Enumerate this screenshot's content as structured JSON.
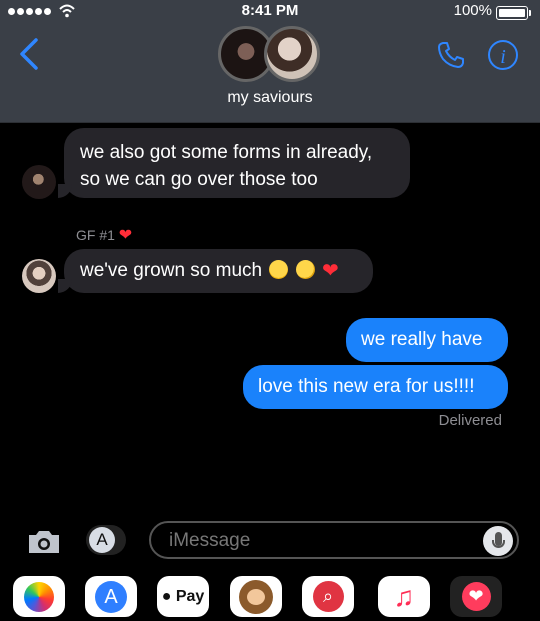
{
  "status": {
    "time": "8:41 PM",
    "battery": "100%"
  },
  "nav": {
    "group_name": "my saviours"
  },
  "messages": [
    {
      "text_line1": "we also got some forms in already,",
      "text_line2": "so we can go over those too"
    },
    {
      "sender": "GF #1",
      "text": "we've grown so much"
    },
    {
      "text": "we really have"
    },
    {
      "text": "love this new era for us!!!!"
    }
  ],
  "delivery": "Delivered",
  "composer": {
    "placeholder": "iMessage"
  },
  "apps": {
    "pay_label": "Pay"
  },
  "icons": {
    "signal": "signal-dots-icon",
    "wifi": "wifi-icon",
    "battery": "battery-icon",
    "back": "chevron-left-icon",
    "phone": "phone-icon",
    "info": "info-icon",
    "camera": "camera-icon",
    "appstore": "app-store-icon",
    "microphone": "microphone-icon",
    "photos": "photos-icon",
    "monkey": "animoji-icon",
    "web": "web-search-icon",
    "music": "music-icon",
    "heart": "heart-icon"
  },
  "colors": {
    "imessage_blue": "#1a82fb",
    "incoming_bubble": "#26252a",
    "status_bar": "#3a3f47",
    "accent_blue": "#2f86ff",
    "heart_red": "#ff2d38"
  }
}
